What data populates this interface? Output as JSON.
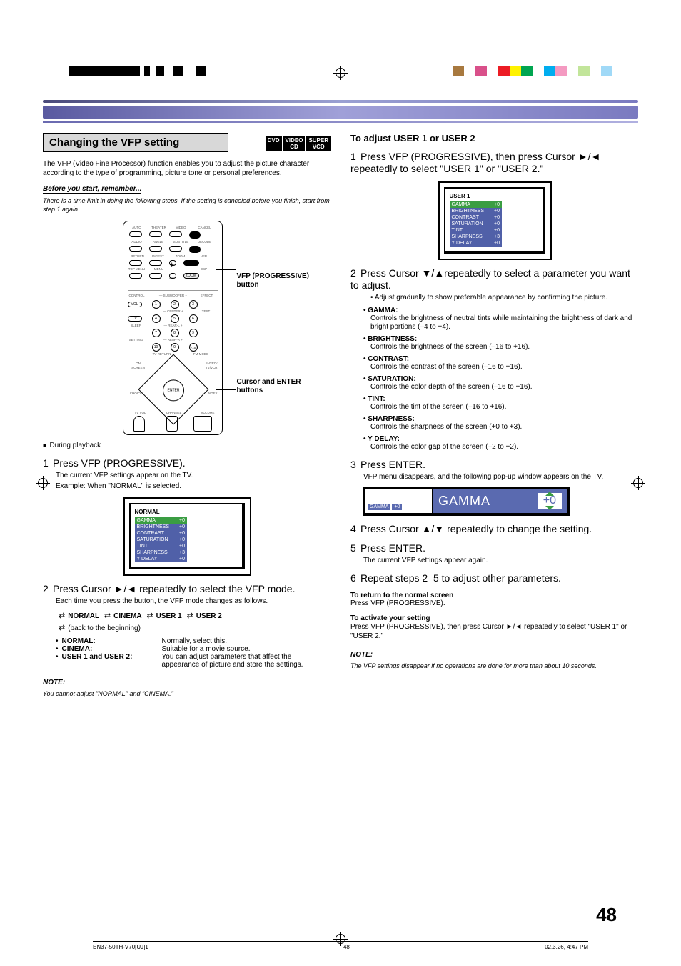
{
  "header": {
    "section_title": "Changing the VFP setting",
    "badges": [
      [
        "DVD"
      ],
      [
        "VIDEO",
        "CD"
      ],
      [
        "SUPER",
        "VCD"
      ]
    ]
  },
  "left": {
    "intro": "The VFP (Video Fine Processor) function enables you to adjust the picture character according to the type of programming, picture tone or personal preferences.",
    "before_title": "Before you start, remember...",
    "before_text": "There is a time limit in doing the following steps. If the setting is canceled before you finish, start from step 1 again.",
    "callout_vfp": "VFP (PROGRESSIVE) button",
    "callout_cur": "Cursor and ENTER buttons",
    "during": "During playback",
    "step1": "Press VFP (PROGRESSIVE).",
    "step1a": "The current VFP settings appear on the TV.",
    "step1b": "Example: When \"NORMAL\" is selected.",
    "vfp_normal_title": "NORMAL",
    "vfp_rows": [
      {
        "k": "GAMMA",
        "v": "+0",
        "hl": true
      },
      {
        "k": "BRIGHTNESS",
        "v": "+0"
      },
      {
        "k": "CONTRAST",
        "v": "+0"
      },
      {
        "k": "SATURATION",
        "v": "+0"
      },
      {
        "k": "TINT",
        "v": "+0"
      },
      {
        "k": "SHARPNESS",
        "v": "+3"
      },
      {
        "k": "Y DELAY",
        "v": "+0"
      }
    ],
    "step2": "Press Cursor ►/◄ repeatedly to select the VFP mode.",
    "step2a": "Each time you press the button, the VFP mode changes as follows.",
    "cycle": [
      "NORMAL",
      "CINEMA",
      "USER 1",
      "USER 2"
    ],
    "cycle_back": "(back to the beginning)",
    "modes": [
      {
        "k": "NORMAL:",
        "v": "Normally, select this."
      },
      {
        "k": "CINEMA:",
        "v": "Suitable for a movie source."
      },
      {
        "k": "USER 1 and USER 2:",
        "v": "You can adjust parameters that affect the appearance of picture and store the settings."
      }
    ],
    "note_label": "NOTE:",
    "note_text": "You cannot adjust \"NORMAL\" and \"CINEMA.\""
  },
  "right": {
    "adjust_title": "To adjust USER 1 or USER 2",
    "r1": "Press VFP (PROGRESSIVE), then press Cursor ►/◄ repeatedly to select \"USER 1\" or \"USER 2.\"",
    "vfp_user_title": "USER 1",
    "r2": "Press Cursor ▼/▲repeatedly to select a parameter you want to adjust.",
    "r2a": "Adjust gradually to show preferable appearance by confirming the picture.",
    "params": [
      {
        "k": "GAMMA:",
        "v": "Controls the brightness of neutral tints while maintaining the brightness of dark and bright portions (–4 to +4)."
      },
      {
        "k": "BRIGHTNESS:",
        "v": "Controls the brightness of the screen (–16 to +16)."
      },
      {
        "k": "CONTRAST:",
        "v": "Controls the contrast of the screen (–16 to +16)."
      },
      {
        "k": "SATURATION:",
        "v": "Controls the color depth of the screen (–16 to +16)."
      },
      {
        "k": "TINT:",
        "v": "Controls the tint of the screen (–16 to +16)."
      },
      {
        "k": "SHARPNESS:",
        "v": "Controls the sharpness of the screen (+0 to +3)."
      },
      {
        "k": "Y DELAY:",
        "v": "Controls the color gap of the screen (–2 to +2)."
      }
    ],
    "r3": "Press ENTER.",
    "r3a": "VFP menu disappears, and the following pop-up window appears on the TV.",
    "popup_label": "GAMMA",
    "popup_val": "+0",
    "popup_chip_k": "GAMMA",
    "popup_chip_v": "+0",
    "r4": "Press Cursor ▲/▼ repeatedly to change the setting.",
    "r5": "Press ENTER.",
    "r5a": "The current VFP settings appear again.",
    "r6": "Repeat steps 2–5 to adjust other parameters.",
    "return_title": "To return to the normal screen",
    "return_text": "Press VFP (PROGRESSIVE).",
    "activate_title": "To activate your setting",
    "activate_text": "Press VFP (PROGRESSIVE), then press Cursor ►/◄ repeatedly to select \"USER 1\" or \"USER 2.\"",
    "note_label": "NOTE:",
    "note_text": "The VFP settings disappear if no operations are done for more than about 10 seconds."
  },
  "page_number": "48",
  "footer": {
    "left": "EN37-50TH-V70[UJ]1",
    "mid": "48",
    "right": "02.3.26, 4:47 PM"
  },
  "remote_labels": {
    "rows": [
      [
        "AUTO",
        "THEATER",
        "VIDEO",
        "CANCEL"
      ],
      [
        "AUDIO",
        "ANGLE",
        "SUBTITLE",
        "DECODE"
      ],
      [
        "RETURN",
        "DIGEST",
        "ZOOM",
        "VFP"
      ],
      [
        "TOP MENU",
        "MENU",
        "",
        "",
        "DSP"
      ]
    ],
    "mid_headers_left": "CONTROL",
    "mid_headers_center": "— SUBWOOFER +",
    "mid_headers_right": "EFFECT",
    "vol": "VOL",
    "center_lbl": "—   CENTER   +",
    "test": "TEST",
    "tv": "TV",
    "sleep": "SLEEP",
    "rear_l": "—   REAR-L   +",
    "rear_r": "—   REAR-R   +",
    "setting": "SETTING",
    "tv_return": "TV RETURN",
    "fm_mode": "FM MODE",
    "plus10": "+10",
    "on_screen_label": "ON SCREEN",
    "intro_tvvcr_label": "INTRO/ TV/VCR",
    "choice": "CHOICE",
    "index": "INDEX",
    "enter": "ENTER",
    "tv_vol": "TV VOL",
    "channel": "CHANNEL",
    "volume": "VOLUME",
    "numbers": [
      "1",
      "2",
      "3",
      "4",
      "5",
      "6",
      "7",
      "8",
      "9",
      "10",
      "0"
    ]
  }
}
